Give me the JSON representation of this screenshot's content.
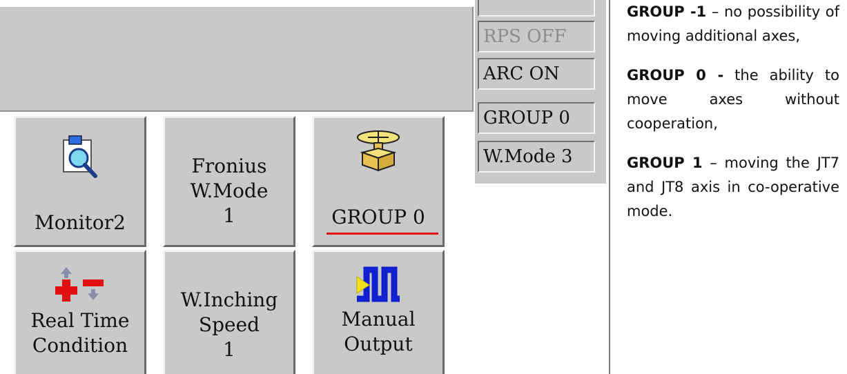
{
  "status_panel": {
    "items": [
      {
        "label": "RPS OFF",
        "dim": true
      },
      {
        "label": "ARC ON",
        "dim": false
      },
      {
        "label": "GROUP 0",
        "dim": false
      },
      {
        "label": "W.Mode 3",
        "dim": false
      }
    ]
  },
  "buttons": {
    "monitor": {
      "label": "Monitor2",
      "icon": "magnifier-monitor-icon"
    },
    "fronius": {
      "line1": "Fronius",
      "line2": "W.Mode",
      "line3": "1"
    },
    "group": {
      "label": "GROUP 0",
      "icon": "positioner-table-icon",
      "underline_color": "#e01010"
    },
    "realtime": {
      "line1": "Real Time",
      "line2": "Condition",
      "icon": "plus-minus-arrows-icon"
    },
    "inching": {
      "line1": "W.Inching",
      "line2": "Speed",
      "line3": "1"
    },
    "manual": {
      "line1": "Manual",
      "line2": "Output",
      "icon": "pulse-signal-icon"
    }
  },
  "description": {
    "p1_bold": "GROUP -1",
    "p1_text": " – no possibility of moving additional axes,",
    "p2_bold": "GROUP 0 -",
    "p2_text": " the ability to move axes without cooperation,",
    "p3_bold": "GROUP 1",
    "p3_text": " – moving the JT7 and JT8 axis in co-operative mode."
  },
  "colors": {
    "panel_gray": "#c9c9c9",
    "accent_red": "#e01010"
  }
}
